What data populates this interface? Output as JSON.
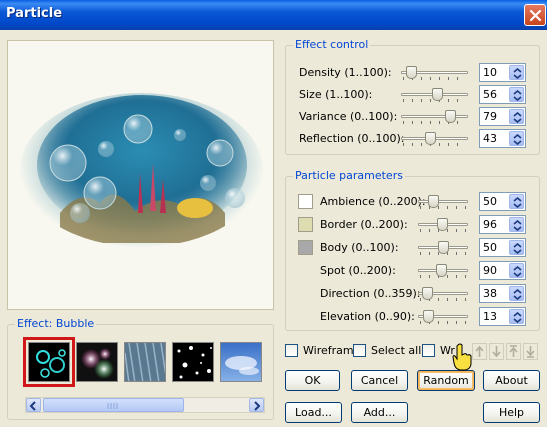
{
  "window": {
    "title": "Particle",
    "close_icon": "close-x-icon"
  },
  "effect_control": {
    "title": "Effect control",
    "rows": [
      {
        "label": "Density (1..100):",
        "value": "10",
        "level": 0.09
      },
      {
        "label": "Size (1..100):",
        "value": "56",
        "level": 0.55
      },
      {
        "label": "Variance (0..100):",
        "value": "79",
        "level": 0.79
      },
      {
        "label": "Reflection (0..100):",
        "value": "43",
        "level": 0.43
      }
    ]
  },
  "particle_parameters": {
    "title": "Particle parameters",
    "rows": [
      {
        "label": "Ambience (0..200):",
        "value": "50",
        "level": 0.25,
        "swatch": "#ffffff"
      },
      {
        "label": "Border (0..200):",
        "value": "96",
        "level": 0.48,
        "swatch": "#dcdcb0"
      },
      {
        "label": "Body (0..100):",
        "value": "50",
        "level": 0.5,
        "swatch": "#a8a8a8"
      },
      {
        "label": "Spot (0..200):",
        "value": "90",
        "level": 0.45
      },
      {
        "label": "Direction (0..359):",
        "value": "38",
        "level": 0.11
      },
      {
        "label": "Elevation (0..90):",
        "value": "13",
        "level": 0.14
      }
    ]
  },
  "effect_group": {
    "title": "Effect: Bubble",
    "thumbnails": [
      "bubble",
      "glow",
      "rain",
      "stars",
      "clouds"
    ],
    "selected_index": 0
  },
  "checkboxes": {
    "wireframe": "Wireframe",
    "select_all": "Select all",
    "wrap": "Wr"
  },
  "buttons": {
    "ok": "OK",
    "cancel": "Cancel",
    "random": "Random",
    "about": "About",
    "load": "Load...",
    "add": "Add...",
    "help": "Help"
  },
  "colors": {
    "title_bar": "#0a57d6",
    "group_title": "#0046d5",
    "selection_outline": "#d01818"
  }
}
